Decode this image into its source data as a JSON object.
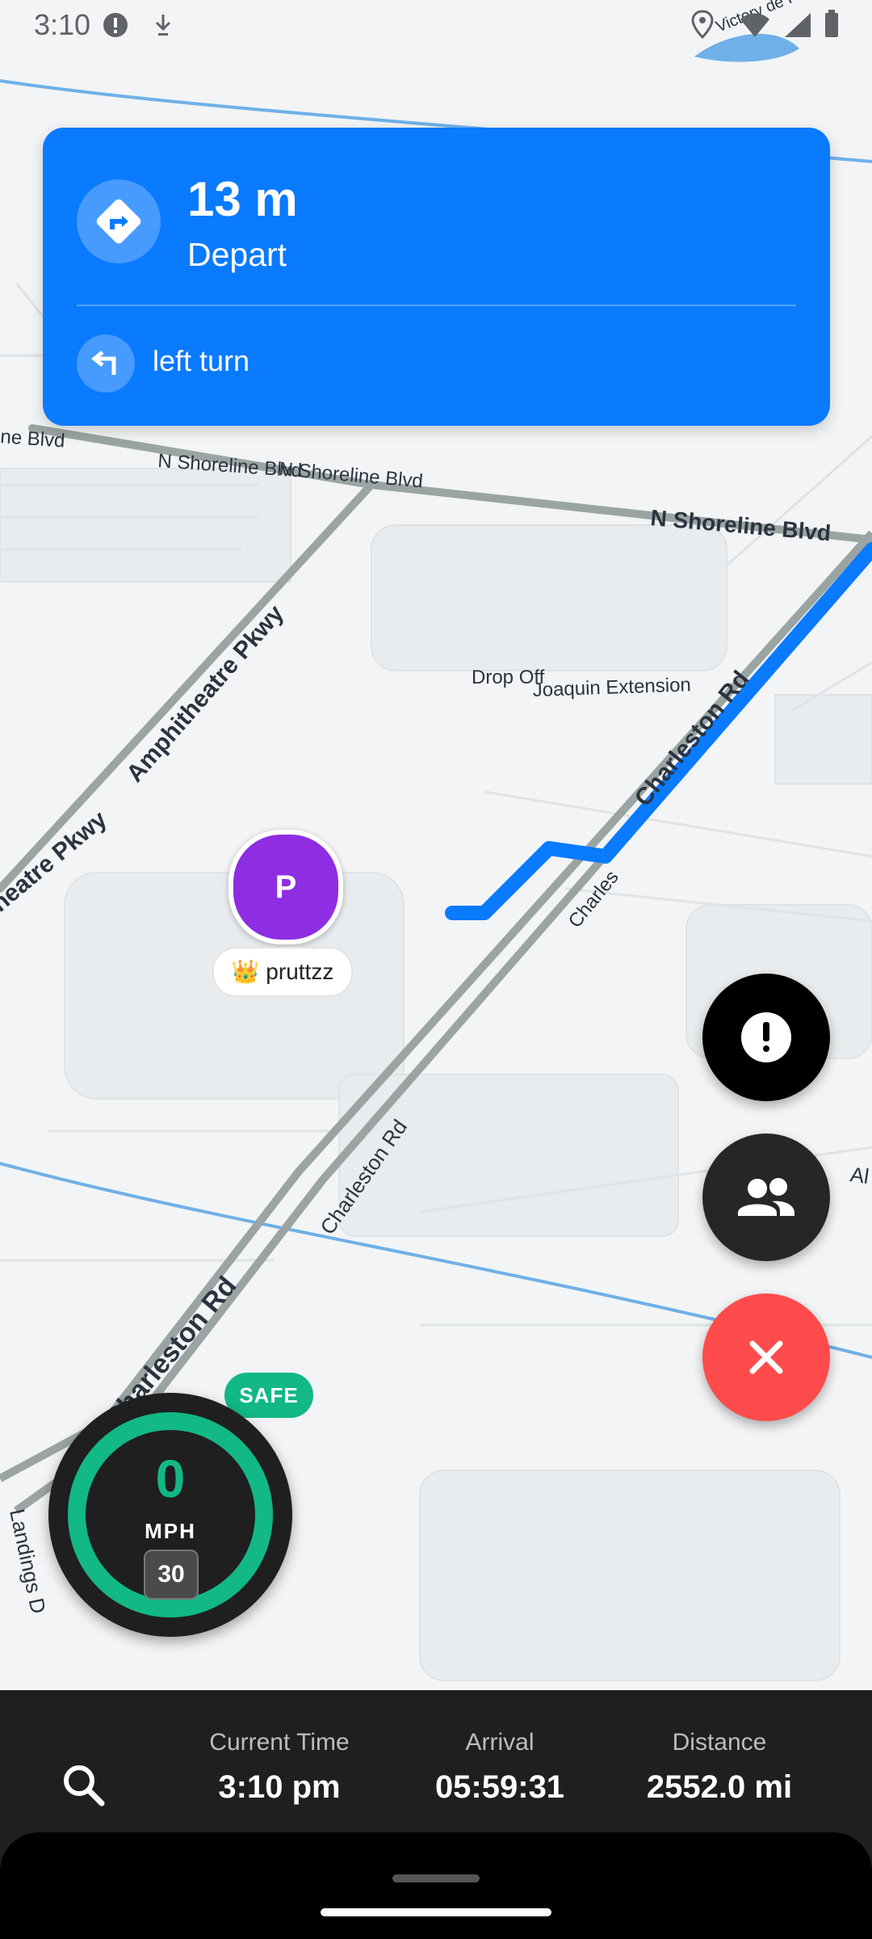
{
  "status_bar": {
    "time": "3:10"
  },
  "navigation": {
    "distance": "13 m",
    "instruction": "Depart",
    "next_instruction": "left turn"
  },
  "map": {
    "labels": [
      "N Shoreline Blvd",
      "N Shoreline Blvd",
      "N Shoreline Blvd",
      "Amphitheatre Pkwy",
      "heatre Pkwy",
      "Drop Off",
      "Joaquin Extension",
      "Charleston Rd",
      "Charles",
      "Charleston Rd",
      "Charleston Rd",
      "ne Blvd",
      "Victory de France Ave",
      "Al",
      "Landings D"
    ],
    "colors": {
      "route": "#0a7aff",
      "road": "#9aa5a3",
      "water": "#6fb0e8",
      "bg": "#f2f4f6"
    }
  },
  "user": {
    "initial": "P",
    "tag": "👑 pruttzz",
    "color": "#8e2de2"
  },
  "fab": {
    "report_icon": "exclamation-icon",
    "people_icon": "people-icon",
    "close_icon": "close-icon",
    "close_color": "#ff4b4b"
  },
  "speed": {
    "status": "SAFE",
    "value": "0",
    "unit": "MPH",
    "limit": "30"
  },
  "bottom_bar": {
    "search_icon": "search-icon",
    "current_time_label": "Current Time",
    "current_time_value": "3:10 pm",
    "arrival_label": "Arrival",
    "arrival_value": "05:59:31",
    "distance_label": "Distance",
    "distance_value": "2552.0 mi"
  }
}
